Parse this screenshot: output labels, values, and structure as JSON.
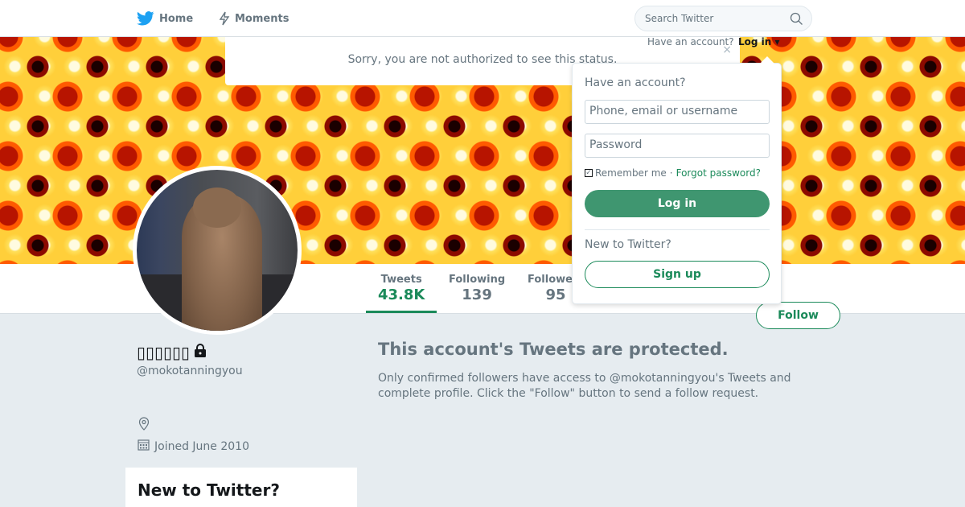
{
  "nav": {
    "home_label": "Home",
    "moments_label": "Moments",
    "search_placeholder": "Search Twitter"
  },
  "notice": {
    "text": "Sorry, you are not authorized to see this status."
  },
  "login_bar": {
    "have_account": "Have an account?",
    "login_label": "Log in"
  },
  "login_dropdown": {
    "heading": "Have an account?",
    "username_placeholder": "Phone, email or username",
    "password_placeholder": "Password",
    "remember_label": "Remember me",
    "separator": "·",
    "forgot_label": "Forgot password?",
    "login_button": "Log in",
    "new_heading": "New to Twitter?",
    "signup_button": "Sign up"
  },
  "profile": {
    "display_name": "▯▯▯▯▯▯",
    "handle": "@mokotanningyou",
    "joined": "Joined June 2010",
    "follow_label": "Follow"
  },
  "stats": [
    {
      "label": "Tweets",
      "value": "43.8K"
    },
    {
      "label": "Following",
      "value": "139"
    },
    {
      "label": "Followers",
      "value": "95"
    }
  ],
  "protected": {
    "title": "This account's Tweets are protected.",
    "description": "Only confirmed followers have access to @mokotanningyou's Tweets and complete profile. Click the \"Follow\" button to send a follow request."
  },
  "sidebar_box": {
    "title": "New to Twitter?"
  },
  "colors": {
    "accent": "#1b8a5a",
    "twitter_blue": "#1da1f2"
  }
}
